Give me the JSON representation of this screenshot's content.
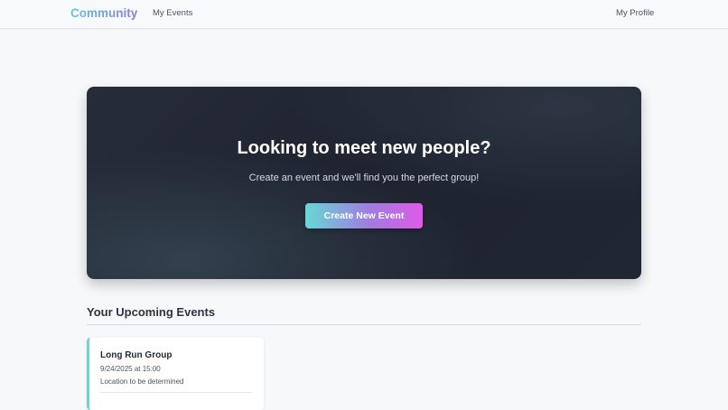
{
  "nav": {
    "brand": "Community",
    "events_link": "My Events",
    "profile_link": "My Profile"
  },
  "hero": {
    "title": "Looking to meet new people?",
    "subtitle": "Create an event and we'll find you the perfect group!",
    "button_label": "Create New Event"
  },
  "upcoming": {
    "heading": "Your Upcoming Events",
    "events": [
      {
        "name": "Long Run Group",
        "datetime": "9/24/2025 at 15:00",
        "location": "Location to be determined"
      }
    ]
  },
  "colors": {
    "accent_teal": "#68d8d6",
    "accent_magenta": "#e05ae8",
    "hero_bg": "#1f2330"
  }
}
